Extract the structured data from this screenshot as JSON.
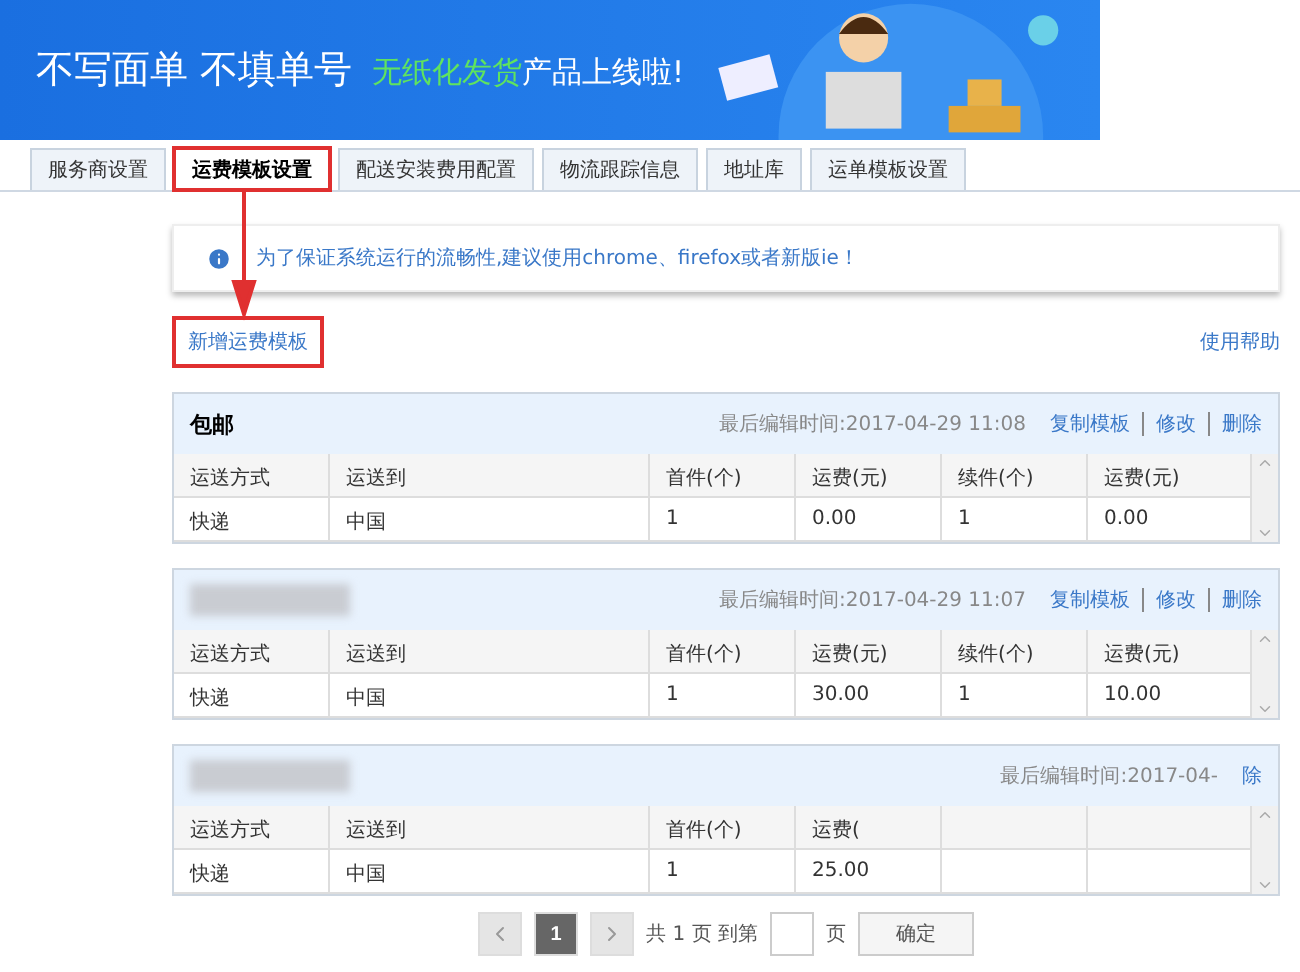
{
  "banner": {
    "headline": "不写面单 不填单号",
    "highlight": "无纸化发货",
    "tail": "产品上线啦!"
  },
  "tabs": [
    {
      "label": "服务商设置",
      "selected": false,
      "highlighted": false
    },
    {
      "label": "运费模板设置",
      "selected": true,
      "highlighted": true
    },
    {
      "label": "配送安装费用配置",
      "selected": false,
      "highlighted": false
    },
    {
      "label": "物流跟踪信息",
      "selected": false,
      "highlighted": false
    },
    {
      "label": "地址库",
      "selected": false,
      "highlighted": false
    },
    {
      "label": "运单模板设置",
      "selected": false,
      "highlighted": false
    }
  ],
  "notice": "为了保证系统运行的流畅性,建议使用chrome、firefox或者新版ie！",
  "new_template": {
    "label": "新增运费模板",
    "highlighted": true
  },
  "help_link": "使用帮助",
  "templates": [
    {
      "blurred": false,
      "name": "包邮",
      "edited": "最后编辑时间:2017-04-29 11:08",
      "actions": [
        "复制模板",
        "修改",
        "删除"
      ],
      "columns": [
        "运送方式",
        "运送到",
        "首件(个)",
        "运费(元)",
        "续件(个)",
        "运费(元)"
      ],
      "rows": [
        [
          "快递",
          "中国",
          "1",
          "0.00",
          "1",
          "0.00"
        ]
      ]
    },
    {
      "blurred": true,
      "edited": "最后编辑时间:2017-04-29 11:07",
      "actions": [
        "复制模板",
        "修改",
        "删除"
      ],
      "columns": [
        "运送方式",
        "运送到",
        "首件(个)",
        "运费(元)",
        "续件(个)",
        "运费(元)"
      ],
      "rows": [
        [
          "快递",
          "中国",
          "1",
          "30.00",
          "1",
          "10.00"
        ]
      ]
    },
    {
      "blurred": true,
      "edited": "最后编辑时间:2017-04-",
      "actions": [
        "除"
      ],
      "columns": [
        "运送方式",
        "运送到",
        "首件(个)",
        "运费("
      ],
      "rows": [
        [
          "快递",
          "中国",
          "1",
          "25.00"
        ]
      ]
    }
  ],
  "pagination": {
    "pages": [
      {
        "label": "1",
        "selected": true
      }
    ],
    "total": "共 1 页 到第",
    "unit": "页",
    "confirm": "确定"
  }
}
